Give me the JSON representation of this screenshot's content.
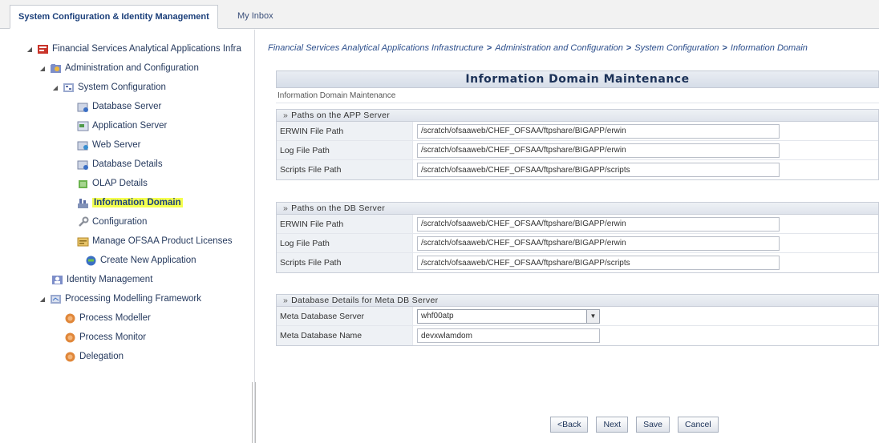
{
  "tabs": [
    {
      "label": "System Configuration & Identity Management"
    },
    {
      "label": "My Inbox"
    }
  ],
  "tree": {
    "root": "Financial Services Analytical Applications Infra",
    "admin": "Administration and Configuration",
    "sysconfig": "System Configuration",
    "database_server": "Database Server",
    "application_server": "Application Server",
    "web_server": "Web Server",
    "database_details": "Database Details",
    "olap_details": "OLAP Details",
    "information_domain": "Information Domain",
    "configuration": "Configuration",
    "manage_licenses": "Manage OFSAA Product Licenses",
    "create_app": "Create New Application",
    "identity_mgmt": "Identity Management",
    "pmf": "Processing Modelling Framework",
    "process_modeller": "Process Modeller",
    "process_monitor": "Process Monitor",
    "delegation": "Delegation"
  },
  "breadcrumb": {
    "items": [
      "Financial Services Analytical Applications Infrastructure",
      "Administration and Configuration",
      "System Configuration",
      "Information Domain"
    ],
    "separator": ">"
  },
  "panel": {
    "title": "Information Domain Maintenance",
    "subtitle": "Information Domain Maintenance"
  },
  "app_server": {
    "heading": "Paths on the APP Server",
    "erwin_label": "ERWIN File Path",
    "erwin_value": "/scratch/ofsaaweb/CHEF_OFSAA/ftpshare/BIGAPP/erwin",
    "log_label": "Log File Path",
    "log_value": "/scratch/ofsaaweb/CHEF_OFSAA/ftpshare/BIGAPP/erwin",
    "scripts_label": "Scripts File Path",
    "scripts_value": "/scratch/ofsaaweb/CHEF_OFSAA/ftpshare/BIGAPP/scripts"
  },
  "db_server": {
    "heading": "Paths on the DB Server",
    "erwin_label": "ERWIN File Path",
    "erwin_value": "/scratch/ofsaaweb/CHEF_OFSAA/ftpshare/BIGAPP/erwin",
    "log_label": "Log File Path",
    "log_value": "/scratch/ofsaaweb/CHEF_OFSAA/ftpshare/BIGAPP/erwin",
    "scripts_label": "Scripts File Path",
    "scripts_value": "/scratch/ofsaaweb/CHEF_OFSAA/ftpshare/BIGAPP/scripts"
  },
  "meta_db": {
    "heading": "Database Details for Meta DB Server",
    "server_label": "Meta Database Server",
    "server_value": "whf00atp",
    "name_label": "Meta Database Name",
    "name_value": "devxwlamdom"
  },
  "buttons": {
    "back": "<Back",
    "next": "Next",
    "save": "Save",
    "cancel": "Cancel"
  },
  "icons": {
    "root": "app-folder-icon",
    "admin": "admin-folder-icon",
    "sysconfig": "settings-folder-icon",
    "db": "database-icon",
    "app_server": "server-icon",
    "web": "web-icon",
    "olap": "cube-icon",
    "domain": "domain-icon",
    "wrench": "wrench-icon",
    "license": "license-icon",
    "create": "create-icon",
    "identity": "identity-icon",
    "process": "process-icon"
  },
  "colors": {
    "highlight": "#f4ff4f",
    "link": "#2d4f8c",
    "accent": "#1b3f7a"
  }
}
